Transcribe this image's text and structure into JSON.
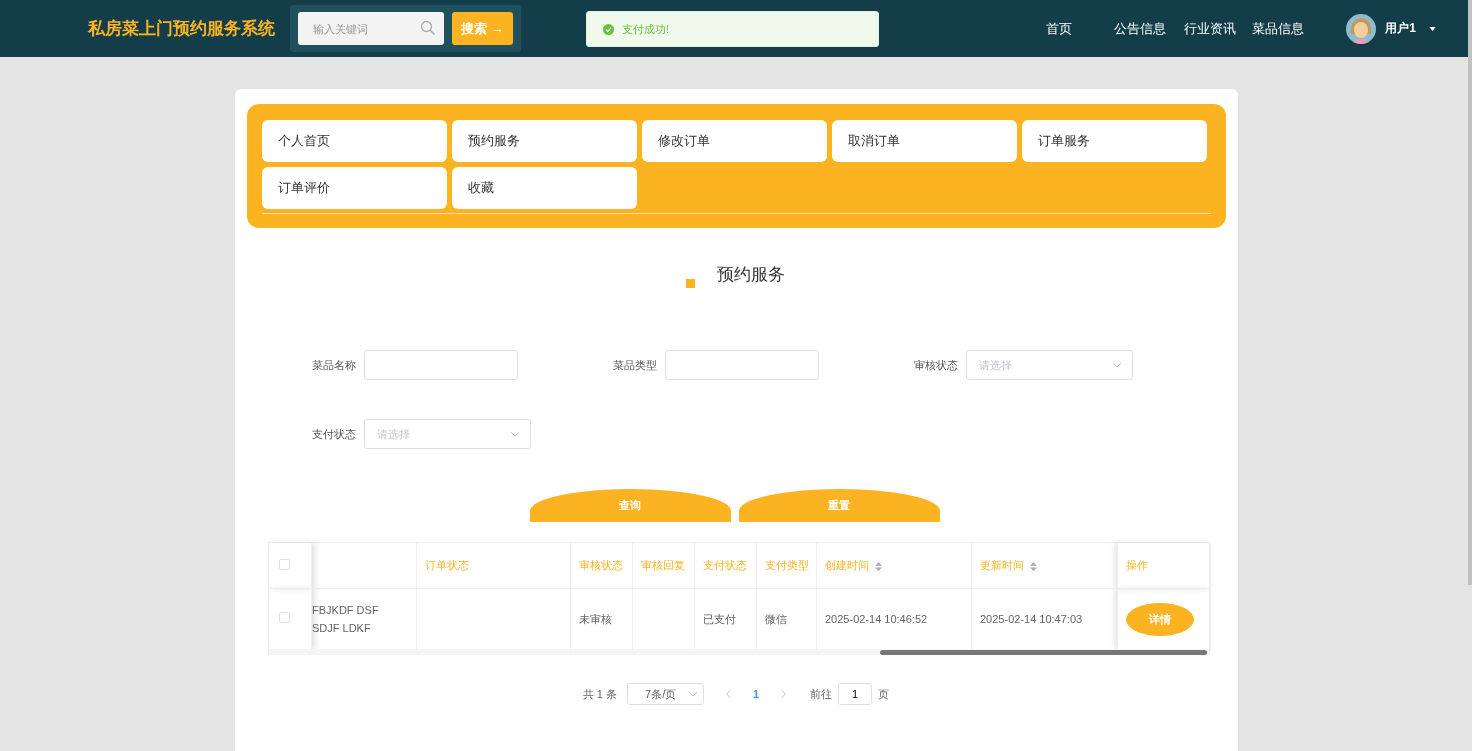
{
  "header": {
    "title": "私房菜上门预约服务系统",
    "search": {
      "placeholder": "输入关键词"
    },
    "search_button": "搜索 →",
    "nav": [
      "首页",
      "公告信息",
      "行业资讯",
      "菜品信息"
    ],
    "user": "用户1"
  },
  "toast": {
    "kind": "success",
    "text": "支付成功!"
  },
  "menu": [
    "个人首页",
    "预约服务",
    "修改订单",
    "取消订单",
    "订单服务",
    "订单评价",
    "收藏"
  ],
  "page_title": "预约服务",
  "filters": [
    {
      "label": "菜品名称",
      "kind": "input"
    },
    {
      "label": "菜品类型",
      "kind": "input"
    },
    {
      "label": "审核状态",
      "kind": "select",
      "placeholder": "请选择"
    },
    {
      "label": "支付状态",
      "kind": "select",
      "placeholder": "请选择"
    }
  ],
  "actions": [
    "查询",
    "重置"
  ],
  "table": {
    "select_all": {
      "checked": false
    },
    "columns": [
      {
        "sortable": false
      },
      {
        "label": "订单状态",
        "sortable": false
      },
      {
        "label": "审核状态",
        "sortable": false
      },
      {
        "label": "审核回复",
        "sortable": false
      },
      {
        "label": "支付状态",
        "sortable": false
      },
      {
        "label": "支付类型",
        "sortable": false
      },
      {
        "label": "创建时间",
        "sortable": true
      },
      {
        "label": "更新时间",
        "sortable": true
      }
    ],
    "action_column": "操作",
    "rows": [
      {
        "checked": false,
        "cells": [
          "FBJKDF DSF SDJF LDKF",
          null,
          "未审核",
          null,
          "已支付",
          "微信",
          "2025-02-14 10:46:52",
          "2025-02-14 10:47:03"
        ],
        "action": "详情"
      }
    ]
  },
  "pagination": {
    "total": "共 1 条",
    "page_size": "7条/页",
    "pages": [
      {
        "label": "1",
        "selected": true
      }
    ],
    "goto_label": "前往",
    "goto_value": "1",
    "goto_suffix": "页"
  }
}
